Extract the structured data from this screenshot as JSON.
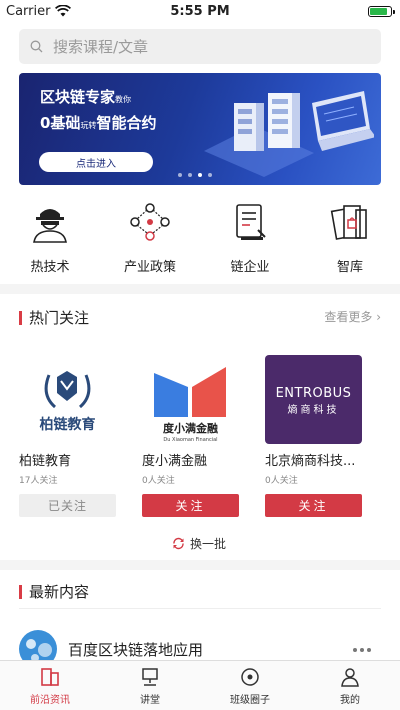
{
  "status": {
    "carrier": "Carrier",
    "time": "5:55 PM",
    "battery_level": 0.85
  },
  "search": {
    "placeholder": "搜索课程/文章"
  },
  "banner": {
    "title1_main": "区块链专家",
    "title1_small": "教你",
    "title2_main": "0基础",
    "title2_small": "玩转",
    "title2_tail": "智能合约",
    "button": "点击进入",
    "slides": 4,
    "active_slide": 3
  },
  "categories": [
    {
      "label": "热技术",
      "icon": "hacker-icon"
    },
    {
      "label": "产业政策",
      "icon": "blockchain-nodes-icon"
    },
    {
      "label": "链企业",
      "icon": "document-icon"
    },
    {
      "label": "智库",
      "icon": "books-icon"
    }
  ],
  "hot": {
    "title": "热门关注",
    "see_more": "查看更多",
    "cards": [
      {
        "name": "柏链教育",
        "logo_text": "柏链教育",
        "count": "17人关注",
        "button": "已关注",
        "followed": true
      },
      {
        "name": "度小满金融",
        "logo_text": "度小满金融",
        "logo_sub": "Du Xiaoman Financial",
        "count": "0人关注",
        "button": "关注",
        "followed": false
      },
      {
        "name": "北京熵商科技...",
        "logo_text": "ENTROBUS",
        "logo_sub": "熵商科技",
        "count": "0人关注",
        "button": "关注",
        "followed": false
      }
    ],
    "refresh": "换一批"
  },
  "latest": {
    "title": "最新内容",
    "items": [
      {
        "title": "百度区块链落地应用"
      }
    ]
  },
  "tabs": [
    {
      "label": "前沿资讯",
      "icon": "news-icon",
      "active": true
    },
    {
      "label": "讲堂",
      "icon": "lecture-icon",
      "active": false
    },
    {
      "label": "班级圈子",
      "icon": "circle-icon",
      "active": false
    },
    {
      "label": "我的",
      "icon": "profile-icon",
      "active": false
    }
  ],
  "colors": {
    "accent": "#d33a45",
    "banner": "#1d3a9a"
  }
}
